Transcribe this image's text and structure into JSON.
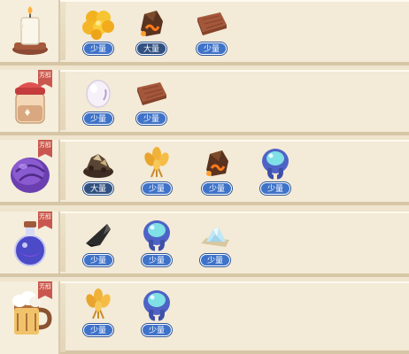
{
  "recipes": [
    {
      "product_icon": "candle",
      "tag": "",
      "ingredients": [
        {
          "icon": "honeycomb",
          "qty": "少量"
        },
        {
          "icon": "charcoal",
          "qty": "大量"
        },
        {
          "icon": "wood-plank",
          "qty": "少量"
        }
      ]
    },
    {
      "product_icon": "jam-jar",
      "tag": "芳醇",
      "ingredients": [
        {
          "icon": "pearl-egg",
          "qty": "少量"
        },
        {
          "icon": "wood-plank",
          "qty": "少量"
        }
      ]
    },
    {
      "product_icon": "purple-bread",
      "tag": "芳醇",
      "ingredients": [
        {
          "icon": "ore-pile",
          "qty": "大量"
        },
        {
          "icon": "wheat",
          "qty": "少量"
        },
        {
          "icon": "charcoal",
          "qty": "少量"
        },
        {
          "icon": "blue-fungus",
          "qty": "少量"
        }
      ]
    },
    {
      "product_icon": "potion-bottle",
      "tag": "芳醇",
      "ingredients": [
        {
          "icon": "black-shard",
          "qty": "少量"
        },
        {
          "icon": "blue-fungus",
          "qty": "少量"
        },
        {
          "icon": "salt-crystal",
          "qty": "少量"
        }
      ]
    },
    {
      "product_icon": "beer-mug",
      "tag": "芳醇",
      "ingredients": [
        {
          "icon": "wheat",
          "qty": "少量"
        },
        {
          "icon": "blue-fungus",
          "qty": "少量"
        }
      ]
    }
  ]
}
